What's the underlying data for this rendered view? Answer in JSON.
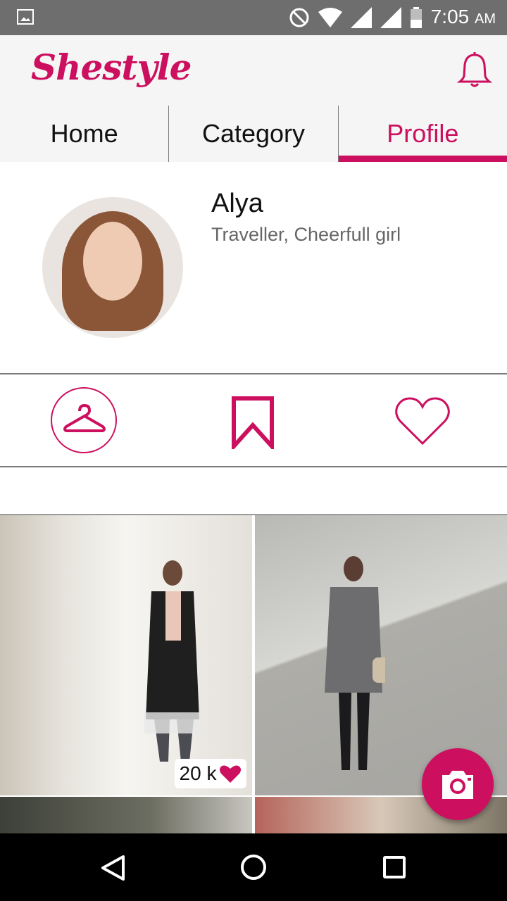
{
  "status_bar": {
    "time": "7:05",
    "ampm": "AM"
  },
  "app": {
    "logo": "Shestyle"
  },
  "tabs": [
    {
      "label": "Home"
    },
    {
      "label": "Category"
    },
    {
      "label": "Profile",
      "active": true
    }
  ],
  "profile": {
    "name": "Alya",
    "bio": "Traveller, Cheerfull girl"
  },
  "feed": {
    "likes_label": "20 k"
  },
  "icons": {
    "notifications": "bell-icon",
    "closet": "hanger-icon",
    "saved": "bookmark-icon",
    "liked": "heart-icon",
    "camera": "camera-icon"
  },
  "colors": {
    "accent": "#cc0f5e",
    "tab_bg": "#f5f5f5",
    "status_bar": "#6e6e6e"
  }
}
